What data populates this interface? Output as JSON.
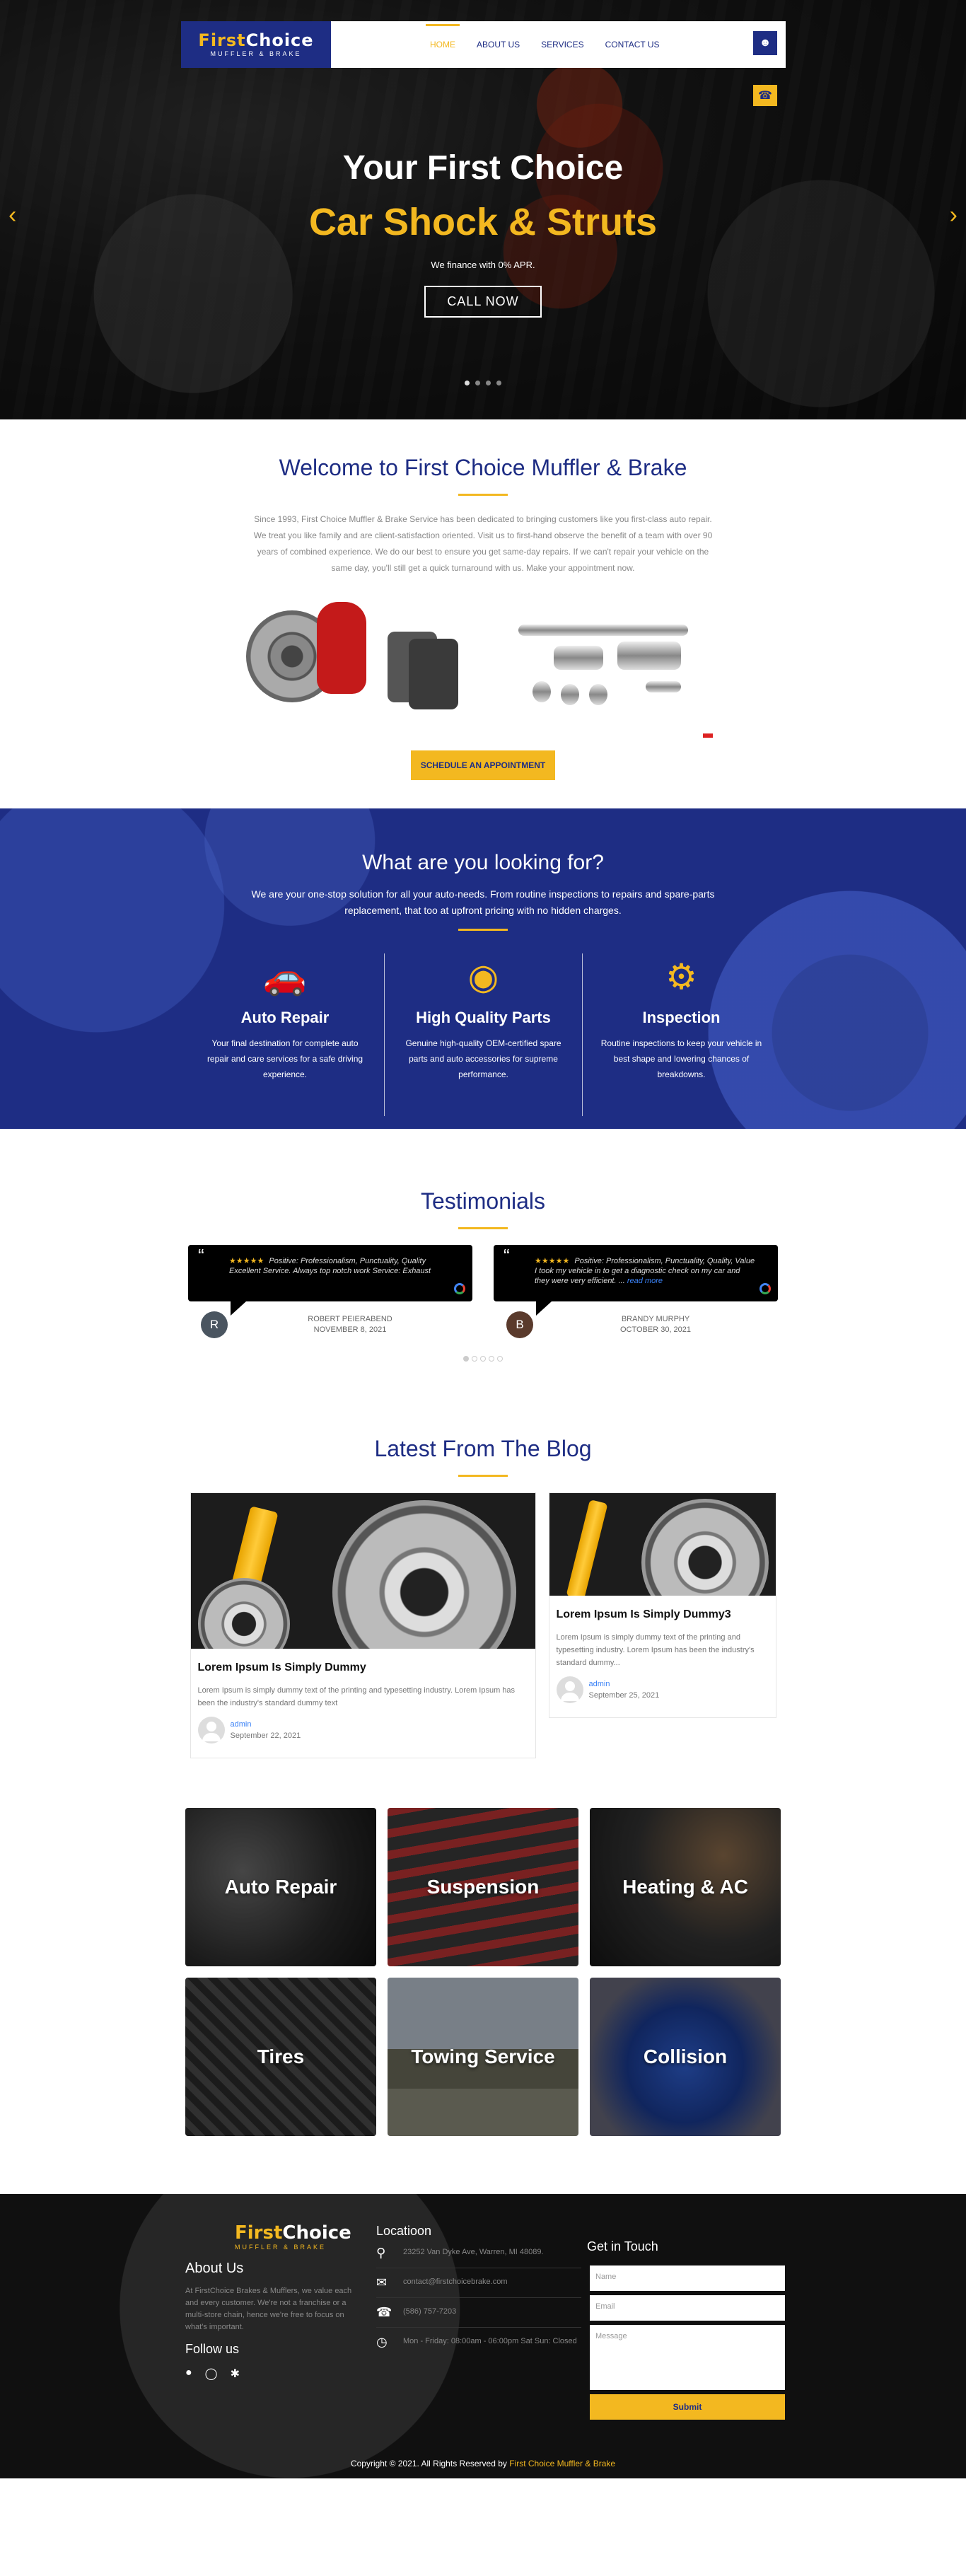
{
  "brand": {
    "name_a": "First",
    "name_b": "Choice",
    "tagline": "MUFFLER & BRAKE"
  },
  "nav": {
    "items": [
      "HOME",
      "ABOUT US",
      "SERVICES",
      "CONTACT US"
    ],
    "active": "HOME"
  },
  "hero": {
    "line1": "Your First Choice",
    "line2": "Car Shock & Struts",
    "finance": "We finance with 0% APR.",
    "cta": "CALL NOW"
  },
  "welcome": {
    "title": "Welcome to First Choice Muffler & Brake",
    "body": "Since 1993, First Choice Muffler & Brake Service has been dedicated to bringing customers like you first-class auto repair. We treat you like family and are client-satisfaction oriented. Visit us to first-hand observe the benefit of a team with over 90 years of combined experience. We do our best to ensure you get same-day repairs. If we can't repair your vehicle on the same day, you'll still get a quick turnaround with us. Make your appointment now.",
    "cta": "SCHEDULE AN APPOINTMENT"
  },
  "looking": {
    "title": "What are you looking for?",
    "lead": "We are your one-stop solution for all your auto-needs. From routine inspections to repairs and spare-parts replacement, that too at upfront pricing with no hidden charges.",
    "features": [
      {
        "icon": "car-repair-icon",
        "title": "Auto Repair",
        "text": "Your final destination for complete auto repair and care services for a safe driving experience."
      },
      {
        "icon": "brake-disc-icon",
        "title": "High Quality Parts",
        "text": "Genuine high-quality OEM-certified spare parts and auto accessories for supreme performance."
      },
      {
        "icon": "inspection-icon",
        "title": "Inspection",
        "text": "Routine inspections to keep your vehicle in best shape and lowering chances of breakdowns."
      }
    ]
  },
  "testimonials": {
    "title": "Testimonials",
    "items": [
      {
        "stars": "★★★★★",
        "text": "Positive: Professionalism, Punctuality, Quality Excellent Service. Always top notch work Service: Exhaust",
        "more": "",
        "initial": "R",
        "avatar_color": "#4a5560",
        "name": "ROBERT PEIERABEND",
        "date": "NOVEMBER 8, 2021"
      },
      {
        "stars": "★★★★★",
        "text": "Positive: Professionalism, Punctuality, Quality, Value I took my vehicle in to get a diagnostic check on my car and they were very efficient. ...",
        "more": "read more",
        "initial": "B",
        "avatar_color": "#5a3a2c",
        "name": "BRANDY MURPHY",
        "date": "OCTOBER 30, 2021"
      }
    ]
  },
  "blog": {
    "title": "Latest From The Blog",
    "posts": [
      {
        "title": "Lorem Ipsum Is Simply Dummy",
        "excerpt": "Lorem Ipsum is simply dummy text of the printing and typesetting industry. Lorem Ipsum has been the industry's standard dummy text",
        "author": "admin",
        "date": "September 22, 2021"
      },
      {
        "title": "Lorem Ipsum Is Simply Dummy3",
        "excerpt": "Lorem Ipsum is simply dummy text of the printing and typesetting industry. Lorem Ipsum has been the industry's standard dummy...",
        "author": "admin",
        "date": "September 25, 2021"
      }
    ]
  },
  "services": [
    "Auto Repair",
    "Suspension",
    "Heating & AC",
    "Tires",
    "Towing Service",
    "Collision"
  ],
  "footer": {
    "about_title": "About Us",
    "about_text": "At FirstChoice Brakes & Mufflers, we value each and every customer. We're not a franchise or a multi-store chain, hence we're free to focus on what's important.",
    "follow": "Follow us",
    "location_title": "Locatioon",
    "address": "23252 Van Dyke Ave, Warren, MI 48089.",
    "email": "contact@firstchoicebrake.com",
    "phone": "(586) 757-7203",
    "hours": "Mon - Friday: 08:00am - 06:00pm Sat Sun: Closed",
    "contact_title": "Get in Touch",
    "form": {
      "name": "Name",
      "email": "Email",
      "message": "Message",
      "submit": "Submit"
    },
    "copyright": "Copyright © 2021. All Rights Reserved by",
    "copyright_brand": "First Choice Muffler & Brake"
  },
  "colors": {
    "navy": "#1e2d84",
    "gold": "#f3b820"
  }
}
